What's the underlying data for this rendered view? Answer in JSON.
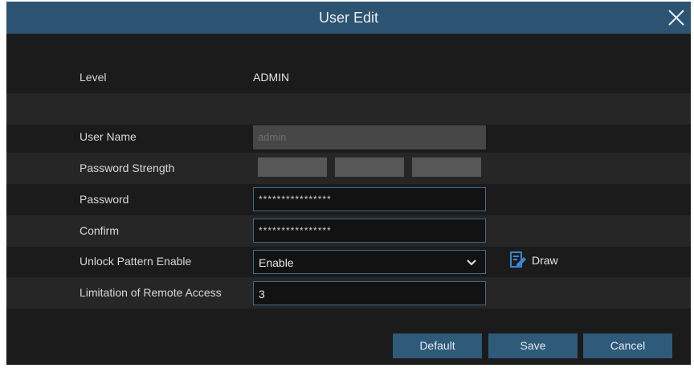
{
  "dialog": {
    "title": "User Edit"
  },
  "form": {
    "level_label": "Level",
    "level_value": "ADMIN",
    "username_label": "User Name",
    "username_value": "admin",
    "strength_label": "Password Strength",
    "strength_level": 0,
    "password_label": "Password",
    "password_value": "****************",
    "confirm_label": "Confirm",
    "confirm_value": "****************",
    "unlock_label": "Unlock Pattern Enable",
    "unlock_value": "Enable",
    "draw_label": "Draw",
    "remote_label": "Limitation of Remote Access",
    "remote_value": "3"
  },
  "buttons": {
    "default": "Default",
    "save": "Save",
    "cancel": "Cancel"
  },
  "icons": {
    "close": "close-icon",
    "chevron": "chevron-down-icon",
    "draw": "edit-pattern-icon"
  },
  "colors": {
    "titlebar": "#2c5371",
    "background": "#1b1b1b",
    "button": "#2f5a7a",
    "field_border": "#3f6a8b",
    "icon_accent": "#3a86d6"
  }
}
